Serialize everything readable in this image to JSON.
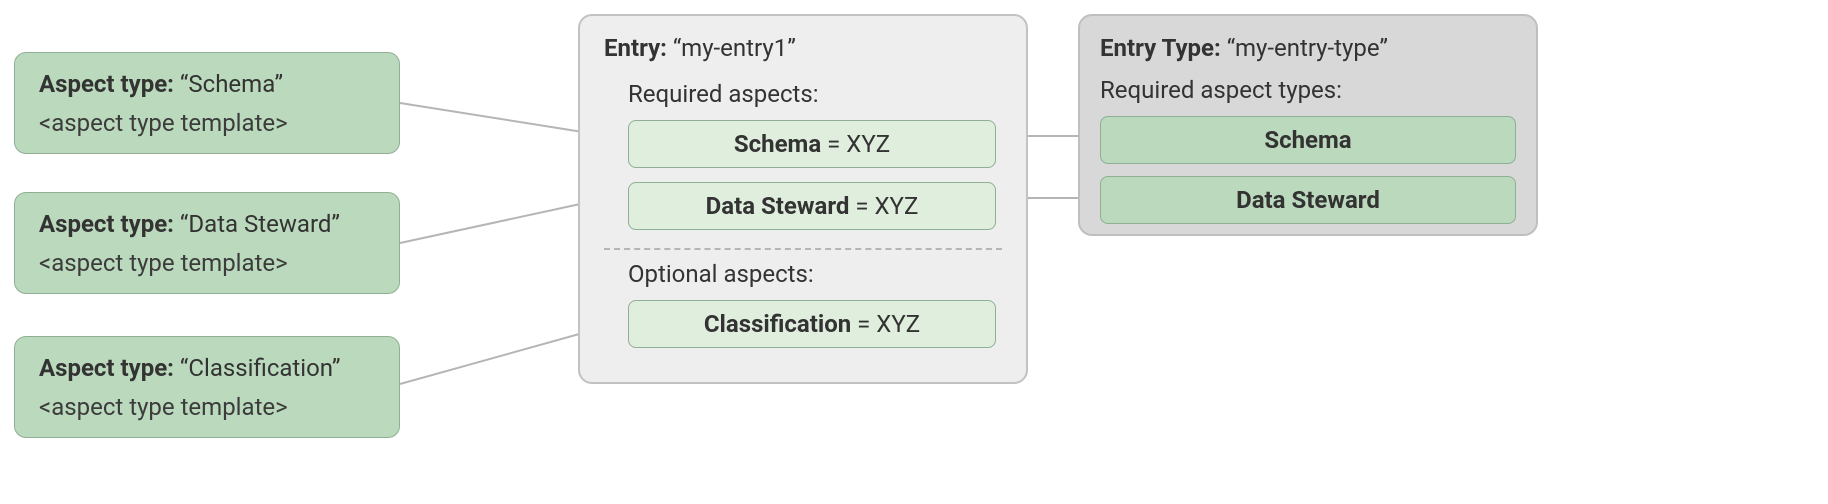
{
  "aspectTypes": [
    {
      "labelPrefix": "Aspect type: ",
      "name": "“Schema”",
      "templateText": "<aspect type template>"
    },
    {
      "labelPrefix": "Aspect type: ",
      "name": "“Data Steward”",
      "templateText": "<aspect type template>"
    },
    {
      "labelPrefix": "Aspect type: ",
      "name": "“Classification”",
      "templateText": "<aspect type template>"
    }
  ],
  "entry": {
    "titlePrefix": "Entry: ",
    "titleValue": "“my-entry1”",
    "requiredLabel": "Required aspects:",
    "optionalLabel": "Optional aspects:",
    "requiredAspects": [
      {
        "key": "Schema",
        "sep": " = ",
        "value": "XYZ"
      },
      {
        "key": "Data Steward",
        "sep": " = ",
        "value": "XYZ"
      }
    ],
    "optionalAspects": [
      {
        "key": "Classification",
        "sep": " = ",
        "value": "XYZ"
      }
    ]
  },
  "entryType": {
    "titlePrefix": "Entry Type: ",
    "titleValue": "“my-entry-type”",
    "requiredLabel": "Required aspect types:",
    "requiredAspectTypes": [
      {
        "label": "Schema"
      },
      {
        "label": "Data Steward"
      }
    ]
  }
}
